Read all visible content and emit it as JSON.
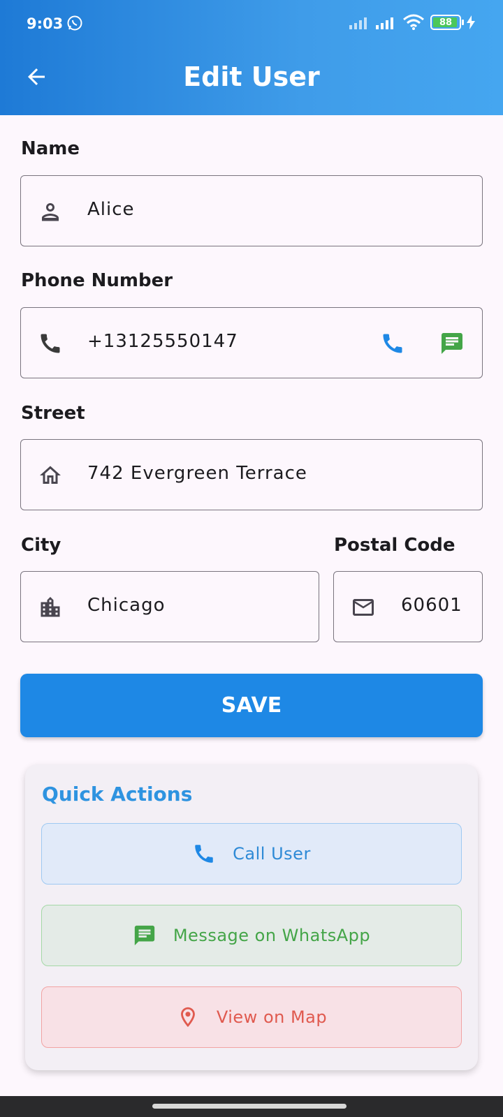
{
  "status_bar": {
    "time": "9:03",
    "battery": "88"
  },
  "header": {
    "title": "Edit User"
  },
  "form": {
    "name": {
      "label": "Name",
      "value": "Alice"
    },
    "phone": {
      "label": "Phone Number",
      "value": "+13125550147"
    },
    "street": {
      "label": "Street",
      "value": "742 Evergreen Terrace"
    },
    "city": {
      "label": "City",
      "value": "Chicago"
    },
    "postal": {
      "label": "Postal Code",
      "value": "60601"
    }
  },
  "save_label": "SAVE",
  "quick_actions": {
    "title": "Quick Actions",
    "call": "Call User",
    "whatsapp": "Message on WhatsApp",
    "map": "View on Map"
  },
  "colors": {
    "header_start": "#1e7ad6",
    "header_end": "#45a6f0",
    "primary": "#1e88e5",
    "whatsapp_green": "#44a548",
    "map_red": "#e05a4f"
  },
  "icons": {
    "back": "arrow-left-icon",
    "name": "person-icon",
    "phone": "phone-icon",
    "street": "home-icon",
    "city": "building-icon",
    "postal": "mail-icon",
    "call": "phone-icon",
    "message": "message-icon",
    "map": "location-pin-icon"
  }
}
